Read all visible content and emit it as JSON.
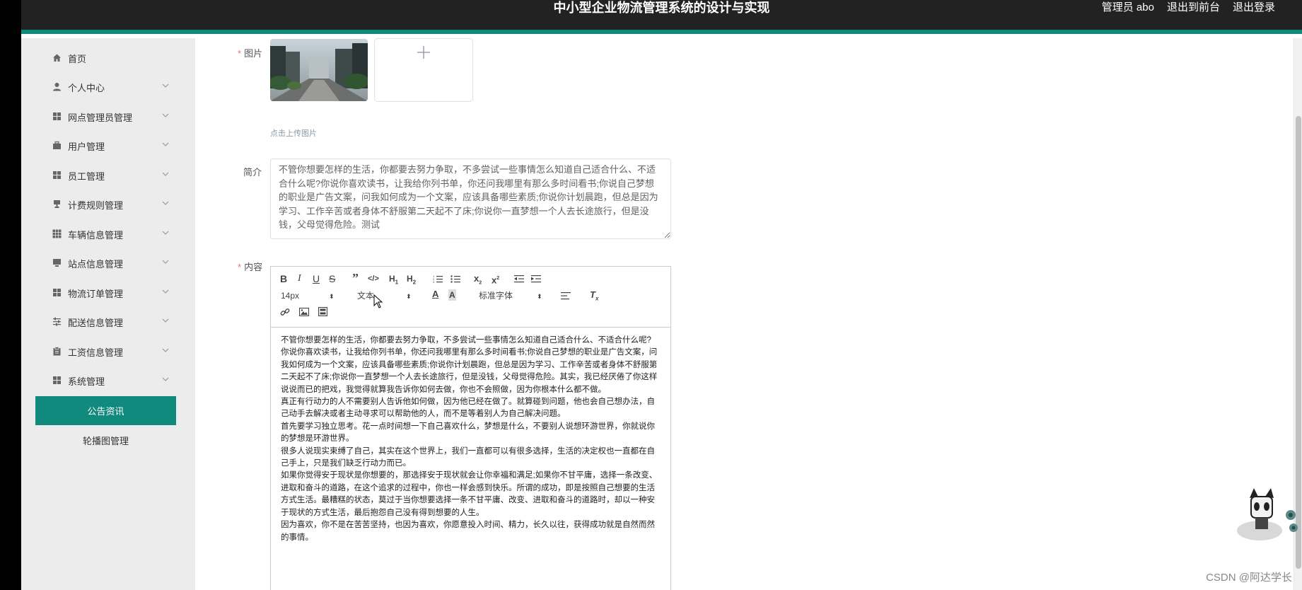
{
  "header": {
    "title": "中小型企业物流管理系统的设计与实现",
    "user": "管理员 abo",
    "link_front": "退出到前台",
    "link_logout": "退出登录"
  },
  "sidebar": {
    "items": [
      {
        "label": "首页",
        "icon": "home-icon"
      },
      {
        "label": "个人中心",
        "icon": "user-icon"
      },
      {
        "label": "网点管理员管理",
        "icon": "grid-icon"
      },
      {
        "label": "用户管理",
        "icon": "briefcase-icon"
      },
      {
        "label": "员工管理",
        "icon": "grid-icon"
      },
      {
        "label": "计费规则管理",
        "icon": "trophy-icon"
      },
      {
        "label": "车辆信息管理",
        "icon": "apps-icon"
      },
      {
        "label": "站点信息管理",
        "icon": "monitor-icon"
      },
      {
        "label": "物流订单管理",
        "icon": "grid-icon"
      },
      {
        "label": "配送信息管理",
        "icon": "sliders-icon"
      },
      {
        "label": "工资信息管理",
        "icon": "clipboard-icon"
      },
      {
        "label": "系统管理",
        "icon": "grid-icon"
      }
    ],
    "sub_items": [
      {
        "label": "公告资讯",
        "active": true
      },
      {
        "label": "轮播图管理",
        "active": false
      }
    ],
    "accent_color": "#0f8a7c"
  },
  "form": {
    "image_label": "图片",
    "upload_tip": "点击上传图片",
    "intro_label": "简介",
    "intro_value": "不管你想要怎样的生活，你都要去努力争取，不多尝试一些事情怎么知道自己适合什么、不适合什么呢?你说你喜欢读书，让我给你列书单，你还问我哪里有那么多时间看书;你说自己梦想的职业是广告文案，问我如何成为一个文案，应该具备哪些素质;你说你计划晨跑，但总是因为学习、工作辛苦或者身体不舒服第二天起不了床;你说你一直梦想一个人去长途旅行，但是没钱，父母觉得危险。测试",
    "content_label": "内容"
  },
  "editor": {
    "size_select": "14px",
    "type_select": "文本",
    "font_select": "标准字体",
    "paragraphs": [
      "不管你想要怎样的生活，你都要去努力争取，不多尝试一些事情怎么知道自己适合什么、不适合什么呢?",
      "你说你喜欢读书，让我给你列书单，你还问我哪里有那么多时间看书;你说自己梦想的职业是广告文案，问我如何成为一个文案，应该具备哪些素质;你说你计划晨跑，但总是因为学习、工作辛苦或者身体不舒服第二天起不了床;你说你一直梦想一个人去长途旅行，但是没钱，父母觉得危险。其实，我已经厌倦了你这样说说而已的把戏，我觉得就算我告诉你如何去做，你也不会照做，因为你根本什么都不做。",
      "真正有行动力的人不需要别人告诉他如何做，因为他已经在做了。就算碰到问题，他也会自己想办法，自己动手去解决或者主动寻求可以帮助他的人，而不是等着别人为自己解决问题。",
      "首先要学习独立思考。花一点时间想一下自己喜欢什么，梦想是什么，不要别人说想环游世界，你就说你的梦想是环游世界。",
      "很多人说现实束缚了自己，其实在这个世界上，我们一直都可以有很多选择，生活的决定权也一直都在自己手上，只是我们缺乏行动力而已。",
      "如果你觉得安于现状是你想要的，那选择安于现状就会让你幸福和满足;如果你不甘平庸，选择一条改变、进取和奋斗的道路，在这个追求的过程中，你也一样会感到快乐。所谓的成功，即是按照自己想要的生活方式生活。最糟糕的状态，莫过于当你想要选择一条不甘平庸、改变、进取和奋斗的道路时，却以一种安于现状的方式生活，最后抱怨自己没有得到想要的人生。",
      "因为喜欢，你不是在苦苦坚持，也因为喜欢，你愿意投入时间、精力，长久以往，获得成功就是自然而然的事情。"
    ]
  },
  "watermark": "CSDN @阿达学长"
}
